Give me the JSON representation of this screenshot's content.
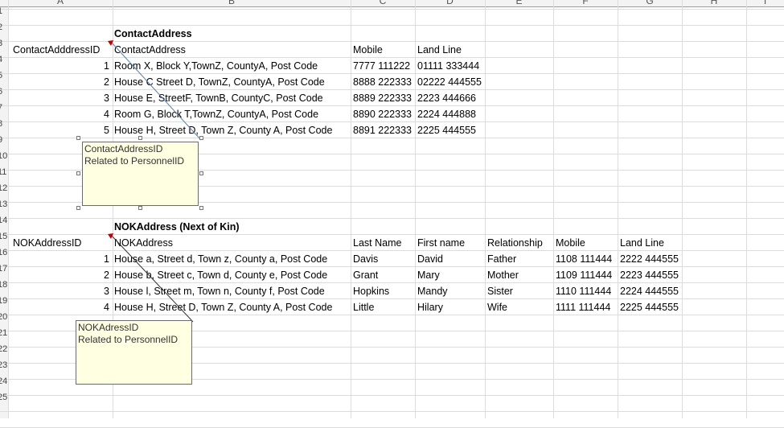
{
  "columns": [
    "A",
    "B",
    "C",
    "D",
    "E",
    "F",
    "G",
    "H",
    "I"
  ],
  "rows": [
    "1",
    "2",
    "3",
    "4",
    "5",
    "6",
    "7",
    "8",
    "9",
    "10",
    "11",
    "12",
    "13",
    "14",
    "15",
    "16",
    "17",
    "18",
    "19",
    "20",
    "21",
    "22",
    "23",
    "24",
    "25"
  ],
  "contact": {
    "title": "ContactAddress",
    "headers": {
      "id": "ContactAdddressID",
      "address": "ContactAddress",
      "mobile": "Mobile",
      "landline": "Land Line"
    },
    "rows": [
      {
        "id": "1",
        "address": "Room X, Block Y,TownZ, CountyA, Post Code",
        "mobile": "7777 111222",
        "landline": "01111 333444"
      },
      {
        "id": "2",
        "address": "House C Street D, TownZ, CountyA, Post Code",
        "mobile": "8888 222333",
        "landline": "02222 444555"
      },
      {
        "id": "3",
        "address": "House E, StreetF, TownB, CountyC, Post Code",
        "mobile": "8889 222333",
        "landline": "2223 444666"
      },
      {
        "id": "4",
        "address": "Room G, Block T,TownZ, CountyA, Post Code",
        "mobile": "8890 222333",
        "landline": "2224 444888"
      },
      {
        "id": "5",
        "address": "House H, Street D, Town Z, County A, Post Code",
        "mobile": "8891 222333",
        "landline": "2225 444555"
      }
    ],
    "comment": {
      "line1": "ContactAddressID",
      "line2": "Related to PersonnelID"
    }
  },
  "nok": {
    "title": "NOKAddress (Next of Kin)",
    "headers": {
      "id": "NOKAddressID",
      "address": "NOKAddress",
      "last": "Last Name",
      "first": "First name",
      "relationship": "Relationship",
      "mobile": "Mobile",
      "landline": "Land Line"
    },
    "rows": [
      {
        "id": "1",
        "address": "House a, Street d, Town z, County a, Post Code",
        "last": "Davis",
        "first": "David",
        "relationship": "Father",
        "mobile": "1108 111444",
        "landline": "2222 444555"
      },
      {
        "id": "2",
        "address": "House b, Street c, Town d, County e, Post Code",
        "last": "Grant",
        "first": "Mary",
        "relationship": "Mother",
        "mobile": "1109 111444",
        "landline": "2223 444555"
      },
      {
        "id": "3",
        "address": "House l, Street m, Town n, County f, Post Code",
        "last": "Hopkins",
        "first": "Mandy",
        "relationship": "Sister",
        "mobile": "1110 111444",
        "landline": "2224 444555"
      },
      {
        "id": "4",
        "address": "House H, Street D, Town Z, County A, Post Code",
        "last": "Little",
        "first": "Hilary",
        "relationship": "Wife",
        "mobile": "1111 111444",
        "landline": "2225 444555"
      }
    ],
    "comment": {
      "line1": "NOKAdressID",
      "line2": "Related to PersonnelID"
    }
  },
  "colors": {
    "grid": "#dadcdd",
    "comment_bg": "#ffffe1",
    "indicator": "#c00000"
  }
}
